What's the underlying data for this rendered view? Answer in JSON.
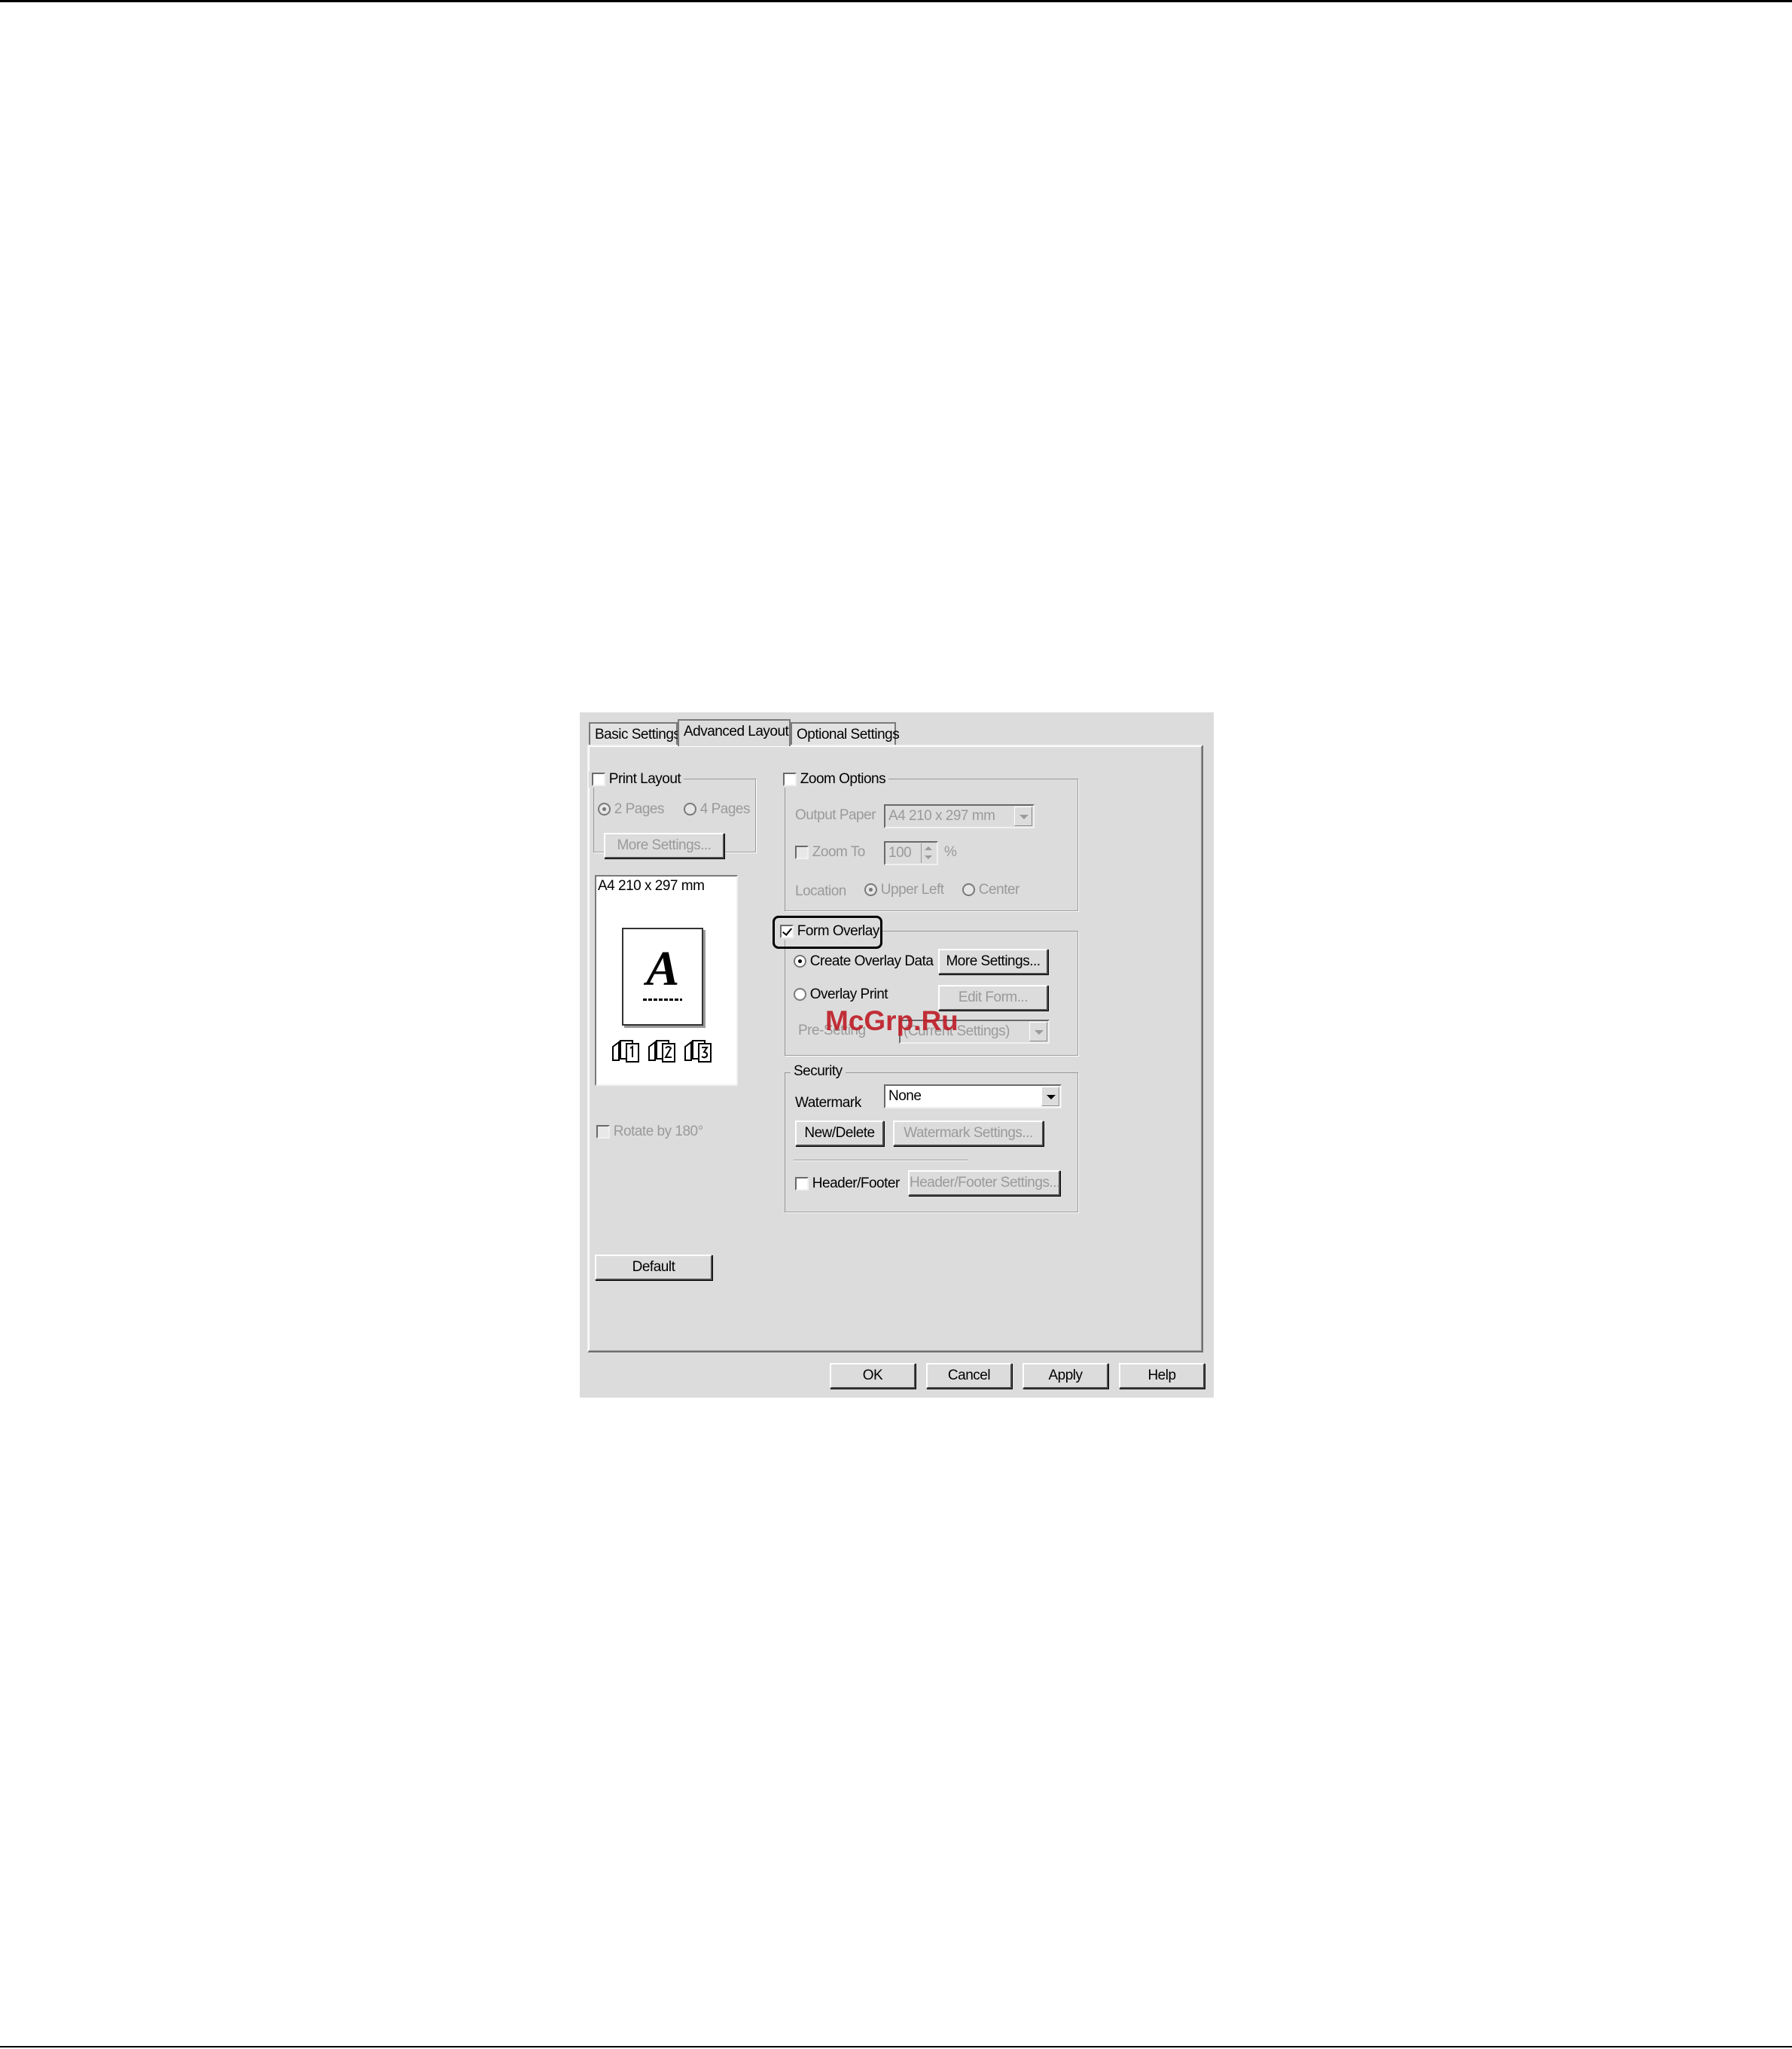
{
  "tabs": [
    {
      "label": "Basic Settings"
    },
    {
      "label": "Advanced Layout"
    },
    {
      "label": "Optional Settings"
    }
  ],
  "print_layout": {
    "label": "Print Layout",
    "checked": false,
    "options": [
      "2 Pages",
      "4 Pages"
    ],
    "selected": "2 Pages",
    "more_settings_label": "More Settings..."
  },
  "preview": {
    "paper_label": "A4 210 x 297 mm",
    "page_letter": "A"
  },
  "rotate": {
    "label": "Rotate by 180°",
    "checked": false
  },
  "zoom_options": {
    "label": "Zoom Options",
    "checked": false,
    "output_paper_label": "Output Paper",
    "output_paper_value": "A4 210 x 297 mm",
    "zoom_to_label": "Zoom To",
    "zoom_value": "100",
    "zoom_unit": "%",
    "location_label": "Location",
    "location_options": [
      "Upper Left",
      "Center"
    ],
    "location_selected": "Upper Left"
  },
  "form_overlay": {
    "label": "Form Overlay",
    "checked": true,
    "create_label": "Create Overlay Data",
    "print_label": "Overlay Print",
    "selected": "Create Overlay Data",
    "more_settings_label": "More Settings...",
    "edit_form_label": "Edit Form...",
    "presetting_label": "Pre-Setting",
    "presetting_value": "(Current Settings)"
  },
  "security": {
    "label": "Security",
    "watermark_label": "Watermark",
    "watermark_value": "None",
    "new_delete_label": "New/Delete",
    "watermark_settings_label": "Watermark Settings...",
    "header_footer_label": "Header/Footer",
    "header_footer_checked": false,
    "header_footer_settings_label": "Header/Footer Settings..."
  },
  "default_label": "Default",
  "footer_buttons": {
    "ok": "OK",
    "cancel": "Cancel",
    "apply": "Apply",
    "help": "Help"
  },
  "overlay_watermark": "McGrp.Ru"
}
